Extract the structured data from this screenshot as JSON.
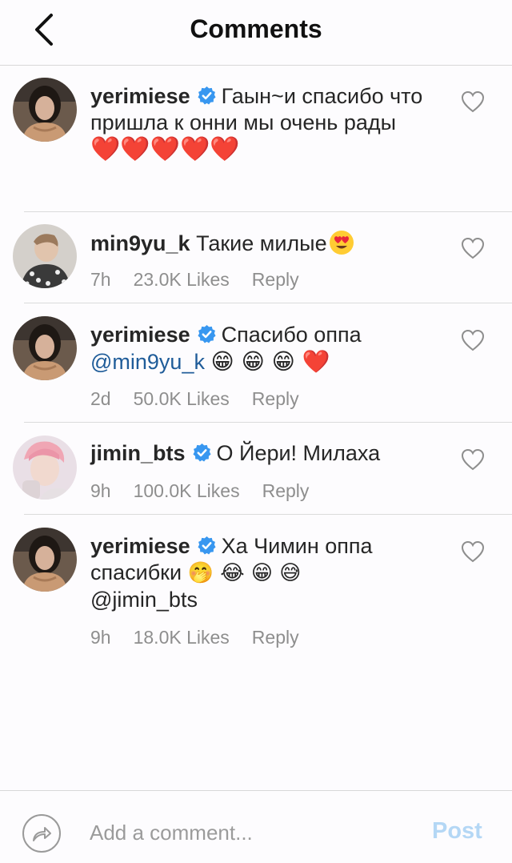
{
  "header": {
    "title": "Comments"
  },
  "comments": [
    {
      "username": "yerimiese",
      "verified": true,
      "text": "Гаын~и спасибо что пришла к онни мы очень рады",
      "emojis": "❤️❤️❤️❤️❤️",
      "time": "",
      "likes": "",
      "reply": ""
    },
    {
      "username": "min9yu_k",
      "verified": false,
      "text": "Такие милые",
      "emojis": "😍",
      "time": "7h",
      "likes": "23.0K Likes",
      "reply": "Reply"
    },
    {
      "username": "yerimiese",
      "verified": true,
      "text": "Спасибо оппа",
      "mention": "@min9yu_k",
      "emojis": "😁 😁 😁 ❤️",
      "time": "2d",
      "likes": "50.0K Likes",
      "reply": "Reply"
    },
    {
      "username": "jimin_bts",
      "verified": true,
      "text": "О Йери! Милаха",
      "time": "9h",
      "likes": "100.0K Likes",
      "reply": "Reply"
    },
    {
      "username": "yerimiese",
      "verified": true,
      "text": "Ха Чимин оппа спасибки",
      "emojis": "🤭 😂 😁 😅",
      "mention": "@jimin_bts",
      "time": "9h",
      "likes": "18.0K Likes",
      "reply": "Reply"
    }
  ],
  "footer": {
    "placeholder": "Add a comment...",
    "post_label": "Post"
  },
  "colors": {
    "mention": "#1f5c99",
    "verified": "#3897f0",
    "post_disabled": "#b4d7f5",
    "meta": "#8e8e8e"
  },
  "icons": {
    "back": "chevron-left-icon",
    "verified": "verified-badge-icon",
    "like": "heart-outline-icon",
    "share": "share-arrow-icon"
  }
}
